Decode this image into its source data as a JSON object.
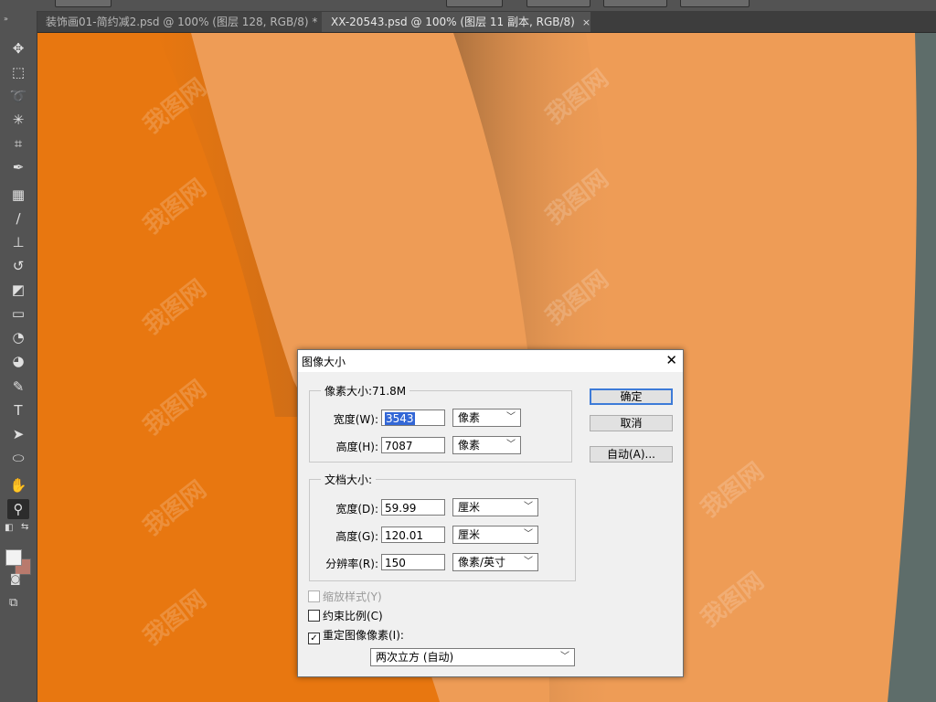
{
  "tabs": [
    {
      "label": "装饰画01-简约减2.psd @ 100% (图层 128, RGB/8) *",
      "close": "×"
    },
    {
      "label": "XX-20543.psd @ 100% (图层 11 副本, RGB/8)",
      "close": "×"
    }
  ],
  "toolbar": {
    "tools": [
      "move-tool",
      "marquee-tool",
      "lasso-tool",
      "magic-wand-tool",
      "crop-tool",
      "eyedropper-tool",
      "healing-brush-tool",
      "brush-tool",
      "clone-stamp-tool",
      "history-brush-tool",
      "eraser-tool",
      "gradient-tool",
      "blur-tool",
      "dodge-tool",
      "pen-tool",
      "type-tool",
      "path-selection-tool",
      "ellipse-tool",
      "hand-tool",
      "zoom-tool"
    ],
    "foreground_color": "#f2f2f2",
    "background_color": "#b97a6d"
  },
  "canvas": {
    "colors": {
      "orange": "#e87710",
      "light_orange": "#ee9c56",
      "gray": "#5e6d6a"
    },
    "watermark": "我图网"
  },
  "dialog": {
    "title": "图像大小",
    "close": "✕",
    "pixel_group": {
      "legend": "像素大小:71.8M",
      "width_label": "宽度(W):",
      "width_value": "3543",
      "width_unit": "像素",
      "height_label": "高度(H):",
      "height_value": "7087",
      "height_unit": "像素"
    },
    "doc_group": {
      "legend": "文档大小:",
      "width_label": "宽度(D):",
      "width_value": "59.99",
      "width_unit": "厘米",
      "height_label": "高度(G):",
      "height_value": "120.01",
      "height_unit": "厘米",
      "res_label": "分辨率(R):",
      "res_value": "150",
      "res_unit": "像素/英寸"
    },
    "buttons": {
      "ok": "确定",
      "cancel": "取消",
      "auto": "自动(A)..."
    },
    "checks": {
      "scale_styles": "缩放样式(Y)",
      "constrain": "约束比例(C)",
      "resample": "重定图像像素(I):",
      "resample_checked": "✓"
    },
    "resample_method": "两次立方 (自动)"
  }
}
